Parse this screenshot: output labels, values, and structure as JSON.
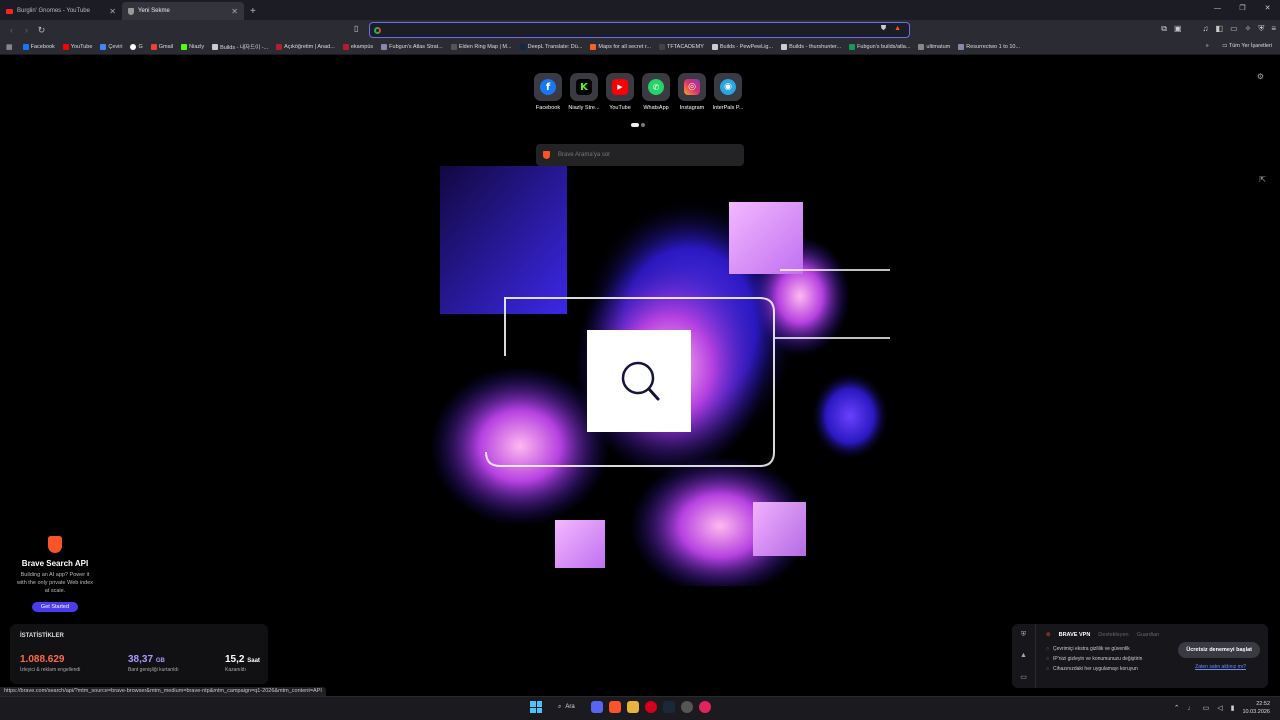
{
  "tabs": [
    {
      "title": "Burglin' Gnomes - YouTube",
      "icon": "youtube-icon",
      "active": false
    },
    {
      "title": "Yeni Sekme",
      "icon": "brave-shield-icon",
      "active": true
    }
  ],
  "toolbar": {
    "url_value": "",
    "bookmarks_right_label": "Tüm Yer İşaretleri"
  },
  "bookmarks": [
    {
      "label": "Facebook",
      "color": "#1877f2"
    },
    {
      "label": "YouTube",
      "color": "#ff0000"
    },
    {
      "label": "Çeviri",
      "color": "#4285f4"
    },
    {
      "label": "G",
      "color": "#ffffff"
    },
    {
      "label": "Gmail",
      "color": "#ea4335"
    },
    {
      "label": "Niazly",
      "color": "#53fc18"
    },
    {
      "label": "Builds - 내자드이 -...",
      "color": "#cccccc"
    },
    {
      "label": "Açıköğretim | Anad...",
      "color": "#b01e2f"
    },
    {
      "label": "ekampüs",
      "color": "#b01e2f"
    },
    {
      "label": "Fubgun's Atlas Strat...",
      "color": "#8888aa"
    },
    {
      "label": "Elden Ring Map | M...",
      "color": "#555555"
    },
    {
      "label": "DeepL Translate: Dü...",
      "color": "#0f2b46"
    },
    {
      "label": "Maps for all secret r...",
      "color": "#f26522"
    },
    {
      "label": "TFTACADEMY",
      "color": "#444444"
    },
    {
      "label": "Builds - PewPewLig...",
      "color": "#cccccc"
    },
    {
      "label": "Builds - thurshunter...",
      "color": "#cccccc"
    },
    {
      "label": "Fubgun's builds/atla...",
      "color": "#0f9d58"
    },
    {
      "label": "ultimatum",
      "color": "#888888"
    },
    {
      "label": "Resurrectwo 1 to 10...",
      "color": "#8888aa"
    }
  ],
  "top_sites": [
    {
      "label": "Facebook",
      "glyph": "f",
      "color": "#1877f2"
    },
    {
      "label": "Niazly Stre...",
      "glyph": "K",
      "color": "#53fc18"
    },
    {
      "label": "YouTube",
      "glyph": "▶",
      "color": "#ff0000"
    },
    {
      "label": "WhatsApp",
      "glyph": "✆",
      "color": "#25d366"
    },
    {
      "label": "Instagram",
      "glyph": "◎",
      "color": "#e1306c"
    },
    {
      "label": "InterPals P...",
      "glyph": "◉",
      "color": "#2aa6e0"
    }
  ],
  "search": {
    "placeholder": "Brave Arama'ya sor"
  },
  "api_card": {
    "title": "Brave Search API",
    "body": "Building an AI app? Power it with the only private Web index at scale.",
    "button": "Get Started"
  },
  "stats": {
    "heading": "İSTATİSTİKLER",
    "items": [
      {
        "value": "1.088.629",
        "unit": "",
        "desc": "İzleyici & reklam engellendi",
        "color": "#fb6a4a"
      },
      {
        "value": "38,37",
        "unit": "GB",
        "desc": "Bant genişliği kurtarıldı",
        "color": "#a99bff"
      },
      {
        "value": "15,2",
        "unit": "Saat",
        "desc": "Kazanıldı",
        "color": "#ffffff"
      }
    ]
  },
  "vpn": {
    "title": "BRAVE VPN",
    "sub1": "Destekleyen",
    "sub2": "Guardian",
    "items": [
      "Çevrimiçi ekstra gizlilik ve güvenlik",
      "IP'nizi gizleyin ve konumunuzu değiştirin",
      "Cihazınızdaki her uygulamayı koruyun"
    ],
    "cta": "Ücretsiz denemeyi başlat",
    "later": "Zaten satın aldınız mı?"
  },
  "status_url": "https://brave.com/search/api/?mtm_source=brave-browser&mtm_medium=brave-ntp&mtm_campaign=q1-2026&mtm_content=API",
  "taskbar": {
    "search_label": "Ara",
    "time": "22:52",
    "date": "10.03.2026"
  }
}
